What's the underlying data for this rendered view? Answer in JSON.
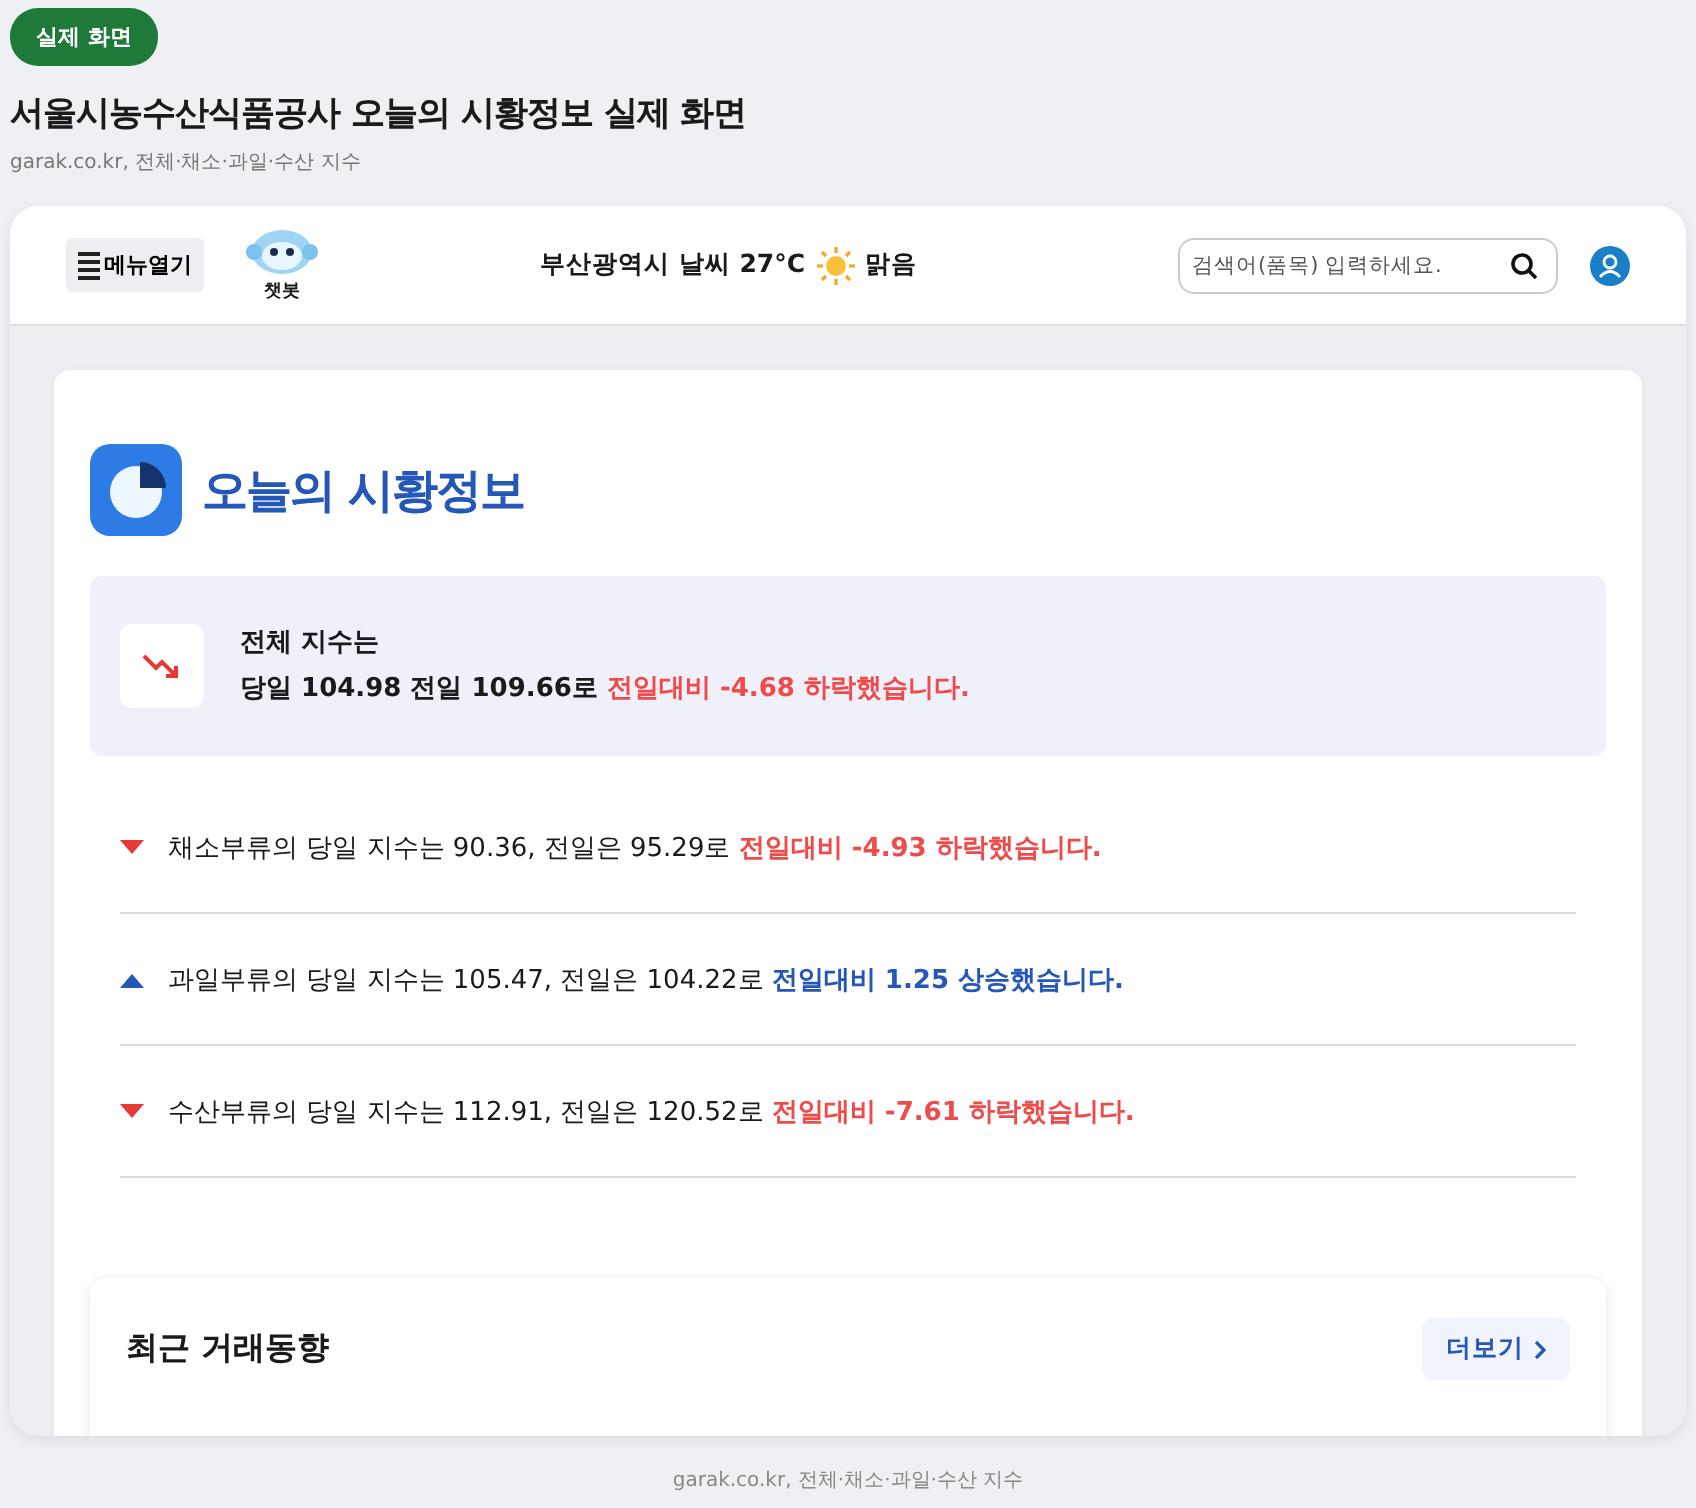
{
  "badge": "실제 화면",
  "title": "서울시농수산식품공사 오늘의 시황정보 실제 화면",
  "subtitle": "garak.co.kr, 전체·채소·과일·수산 지수",
  "header": {
    "menu_button": "메뉴열기",
    "chatbot_label": "챗봇",
    "weather": {
      "location": "부산광역시 날씨 27°C",
      "condition": "맑음"
    },
    "search": {
      "placeholder": "검색어(품목) 입력하세요."
    }
  },
  "panel": {
    "title": "오늘의 시황정보",
    "summary": {
      "label": "전체 지수는",
      "values": "당일 104.98 전일 109.66로",
      "change": "전일대비 -4.68 하락했습니다.",
      "falling": true
    },
    "rows": [
      {
        "text": "채소부류의 당일 지수는 90.36, 전일은 95.29로",
        "change": "전일대비 -4.93 하락했습니다.",
        "falling": true
      },
      {
        "text": "과일부류의 당일 지수는 105.47, 전일은 104.22로",
        "change": "전일대비 1.25 상승했습니다.",
        "falling": false
      },
      {
        "text": "수산부류의 당일 지수는 112.91, 전일은 120.52로",
        "change": "전일대비 -7.61 하락했습니다.",
        "falling": true
      }
    ]
  },
  "recent": {
    "title": "최근 거래동향",
    "more_button": "더보기"
  },
  "caption": "garak.co.kr, 전체·채소·과일·수산 지수"
}
